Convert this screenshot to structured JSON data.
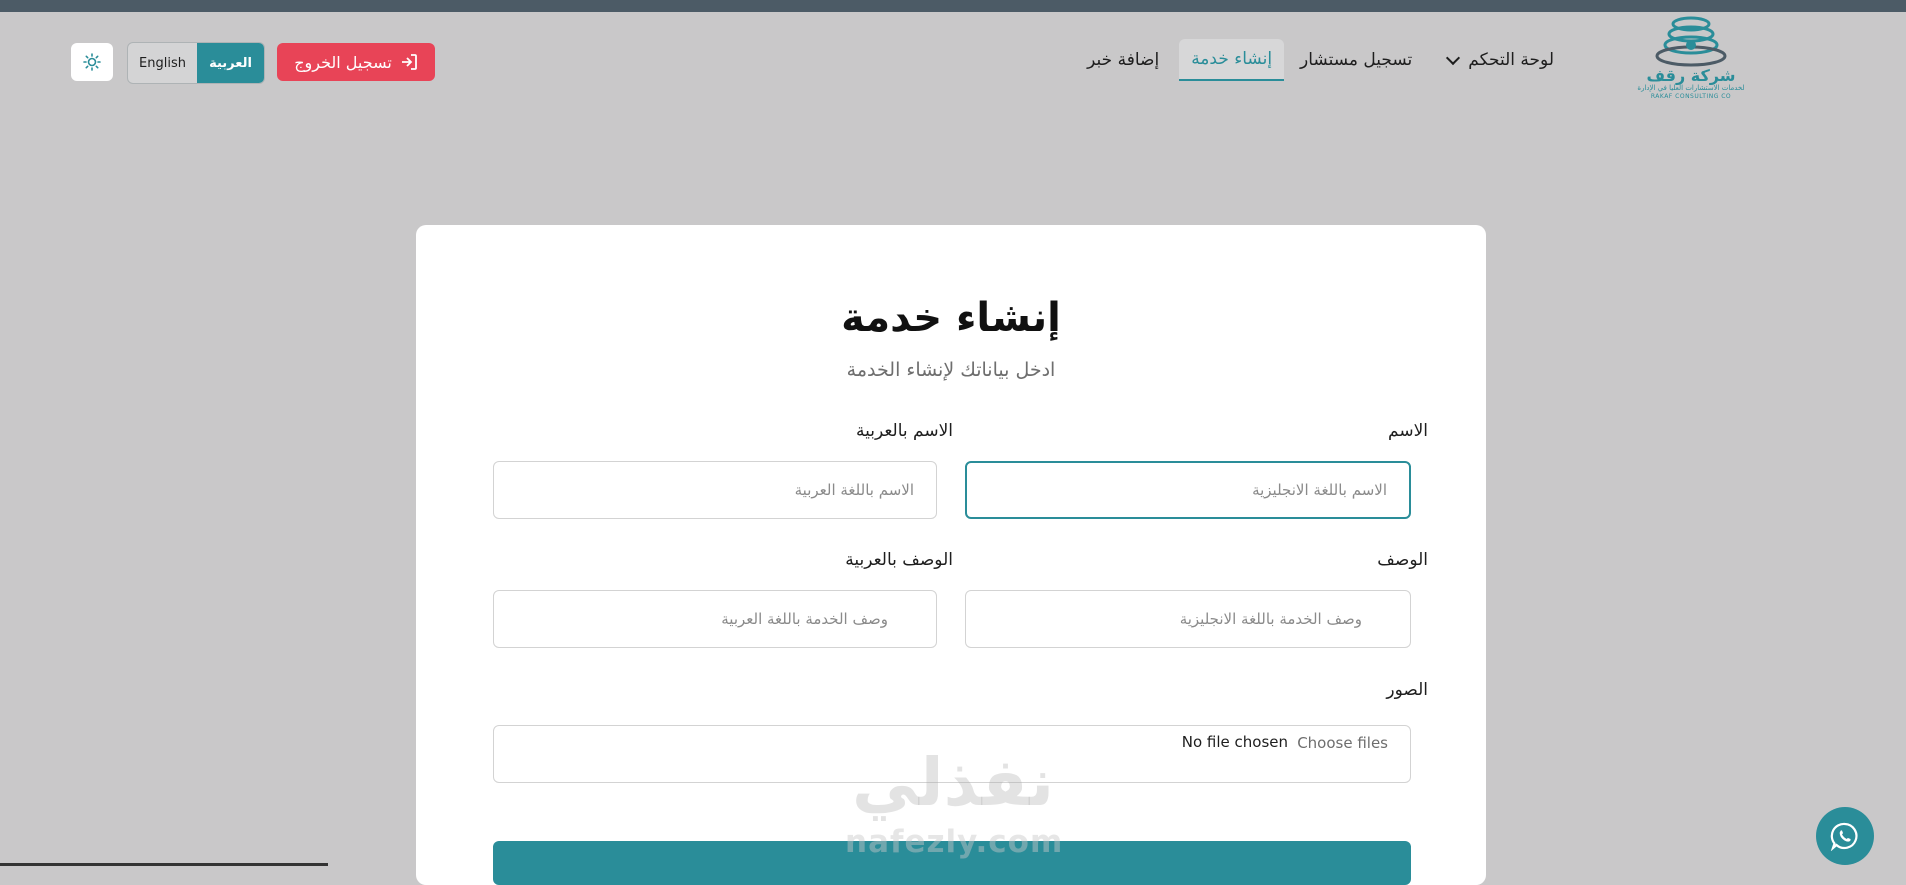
{
  "header": {
    "logo": {
      "brand_ar": "شركة رقف",
      "tagline_ar": "لخدمات الاستشارات العليا في الإدارة",
      "brand_en": "RAKAF CONSULTING CO"
    },
    "nav": [
      {
        "label": "لوحة التحكم",
        "has_dropdown": true
      },
      {
        "label": "تسجيل مستشار"
      },
      {
        "label": "إنشاء خدمة",
        "active": true
      },
      {
        "label": "إضافة خبر"
      }
    ],
    "logout_label": "تسجيل الخروج",
    "lang": {
      "ar": "العربية",
      "en": "English",
      "selected": "ar"
    },
    "theme_icon": "sun-icon"
  },
  "form": {
    "title": "إنشاء خدمة",
    "subtitle": "ادخل بياناتك لإنشاء الخدمة",
    "name": {
      "label": "الاسم",
      "placeholder": "الاسم باللغة الانجليزية"
    },
    "name_ar": {
      "label": "الاسم بالعربية",
      "placeholder": "الاسم باللغة العربية"
    },
    "description": {
      "label": "الوصف",
      "placeholder": "وصف الخدمة باللغة الانجليزية"
    },
    "description_ar": {
      "label": "الوصف بالعربية",
      "placeholder": "وصف الخدمة باللغة العربية"
    },
    "images": {
      "label": "الصور",
      "choose_label": "Choose files",
      "status": "No file chosen"
    }
  },
  "watermark": {
    "ar": "نفذلي",
    "en": "nafezly.com"
  },
  "colors": {
    "accent": "#2a8d99",
    "danger": "#e84457",
    "background": "#c9c8c9",
    "top_strip": "#4c5b66"
  }
}
